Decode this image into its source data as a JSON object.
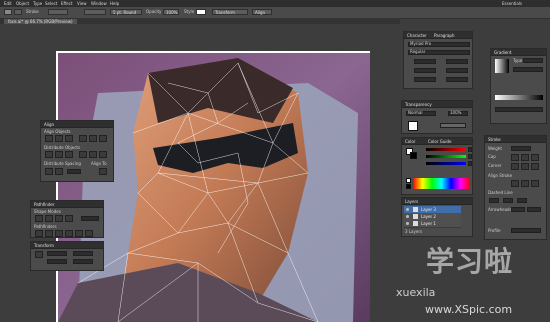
{
  "menubar": {
    "items": [
      "Edit",
      "Object",
      "Type",
      "Select",
      "Effect",
      "View",
      "Window",
      "Help"
    ],
    "workspace": "Essentials"
  },
  "controlbar": {
    "stroke_label": "Stroke",
    "style_label": "5 pt. Round",
    "opacity_label": "Opacity",
    "opacity_value": "100%",
    "style2_label": "Style",
    "transform_label": "Transform",
    "align_label": "Align"
  },
  "document": {
    "tab_label": "face.ai* @ 66.7% (RGB/Preview)"
  },
  "panels": {
    "align": {
      "title": "Align",
      "section1": "Align Objects",
      "section2": "Distribute Objects",
      "section3": "Distribute Spacing",
      "align_to": "Align To"
    },
    "pathfinder": {
      "title": "Pathfinder",
      "section1": "Shape Modes",
      "section2": "Pathfinders"
    },
    "transform": {
      "title": "Transform"
    },
    "character": {
      "title": "Character",
      "tab2": "Paragraph",
      "font": "Myriad Pro",
      "style": "Regular"
    },
    "transparency": {
      "title": "Transparency",
      "mode": "Normal",
      "opacity": "100%"
    },
    "color": {
      "title": "Color",
      "tab2": "Color Guide"
    },
    "layers": {
      "title": "Layers",
      "rows": [
        {
          "name": "Layer 3",
          "selected": true
        },
        {
          "name": "Layer 2",
          "selected": false
        },
        {
          "name": "Layer 1",
          "selected": false
        }
      ],
      "footer": "3 Layers"
    },
    "gradient": {
      "title": "Gradient",
      "type_label": "Type"
    },
    "stroke": {
      "title": "Stroke",
      "weight": "Weight",
      "cap": "Cap",
      "corner": "Corner",
      "align": "Align Stroke",
      "dashed": "Dashed Line",
      "arrowheads": "Arrowheads",
      "profile": "Profile"
    }
  },
  "watermark": {
    "main": "学习啦",
    "sub": "xuexila",
    "url": "www.XSpic.com"
  },
  "colors": {
    "accent_selected": "#3f6ea8",
    "fill_swatch": "#ffffff",
    "stroke_swatch": "#000000"
  }
}
